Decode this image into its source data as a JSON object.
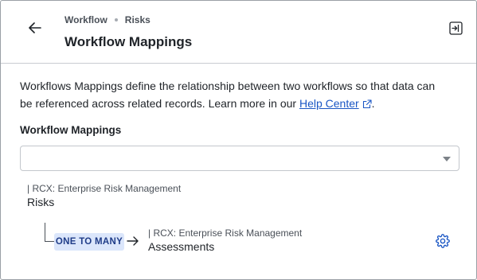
{
  "header": {
    "breadcrumb": [
      "Workflow",
      "Risks"
    ],
    "title": "Workflow Mappings"
  },
  "description": {
    "text": "Workflows Mappings define the relationship between two workflows so that data can be referenced across related records. Learn more in our ",
    "link_label": "Help Center",
    "suffix": "."
  },
  "mappings": {
    "section_label": "Workflow Mappings",
    "select_value": "",
    "source": {
      "subtitle": "| RCX: Enterprise Risk Management",
      "name": "Risks"
    },
    "relation": {
      "label": "ONE TO MANY",
      "target_subtitle": "| RCX: Enterprise Risk Management",
      "target_name": "Assessments"
    }
  },
  "icons": {
    "back": "arrow-left-icon",
    "panel": "panel-exit-icon",
    "external_link": "external-link-icon",
    "dropdown": "chevron-down-icon",
    "relation_arrow": "arrow-right-icon",
    "settings": "gear-icon"
  },
  "colors": {
    "link": "#1a56c4",
    "badge_bg": "#dbe6fb",
    "badge_text": "#1f3c88",
    "settings_icon": "#1a56c4"
  }
}
